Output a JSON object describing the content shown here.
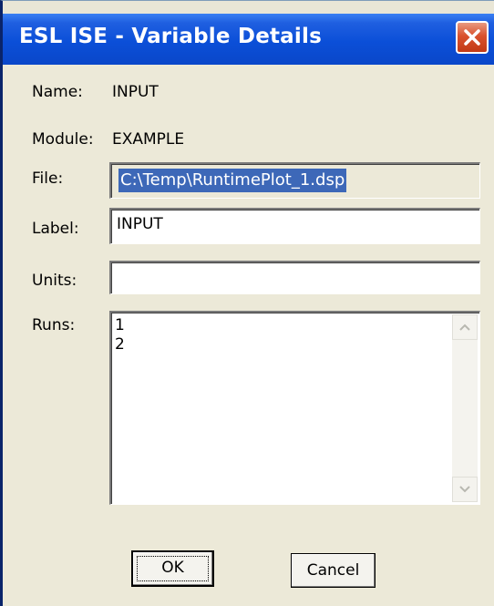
{
  "window": {
    "title": "ESL ISE - Variable Details",
    "close_icon": "close-icon"
  },
  "name": {
    "label": "Name:",
    "value": "INPUT"
  },
  "module": {
    "label": "Module:",
    "value": "EXAMPLE"
  },
  "file": {
    "label": "File:",
    "value": "C:\\Temp\\RuntimePlot_1.dsp"
  },
  "label_field": {
    "label": "Label:",
    "value": "INPUT"
  },
  "units": {
    "label": "Units:",
    "value": ""
  },
  "runs": {
    "label": "Runs:",
    "items": [
      "1",
      "2"
    ]
  },
  "buttons": {
    "ok": "OK",
    "cancel": "Cancel"
  },
  "colors": {
    "titlebar": "#0a47c9",
    "dialog_bg": "#ece9d8",
    "selection": "#3d68b8"
  }
}
